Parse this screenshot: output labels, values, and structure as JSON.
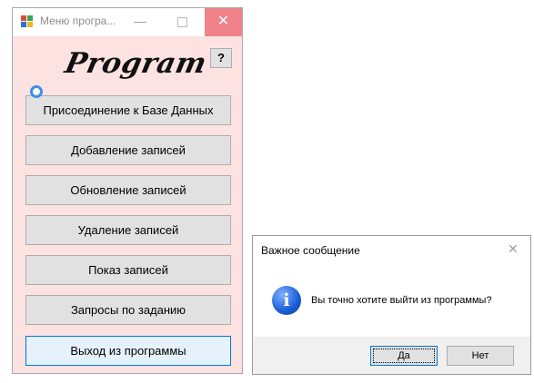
{
  "main_window": {
    "title": "Меню програ...",
    "icons": {
      "app": "app-icon",
      "minimize": "minimize-icon",
      "maximize": "maximize-icon",
      "close": "close-icon"
    },
    "logo_text": "Program",
    "help_label": "?",
    "buttons": [
      {
        "label": "Присоединение к Базе Данных"
      },
      {
        "label": "Добавление записей"
      },
      {
        "label": "Обновление записей"
      },
      {
        "label": "Удаление записей"
      },
      {
        "label": "Показ записей"
      },
      {
        "label": "Запросы по заданию"
      },
      {
        "label": "Выход из программы"
      }
    ]
  },
  "dialog": {
    "title": "Важное сообщение",
    "message": "Вы точно хотите выйти из программы?",
    "icon": "information-icon",
    "yes_label": "Да",
    "no_label": "Нет"
  },
  "colors": {
    "window_bg": "#fce3e1",
    "close_hover": "#f0828a",
    "accent": "#0078d7"
  }
}
